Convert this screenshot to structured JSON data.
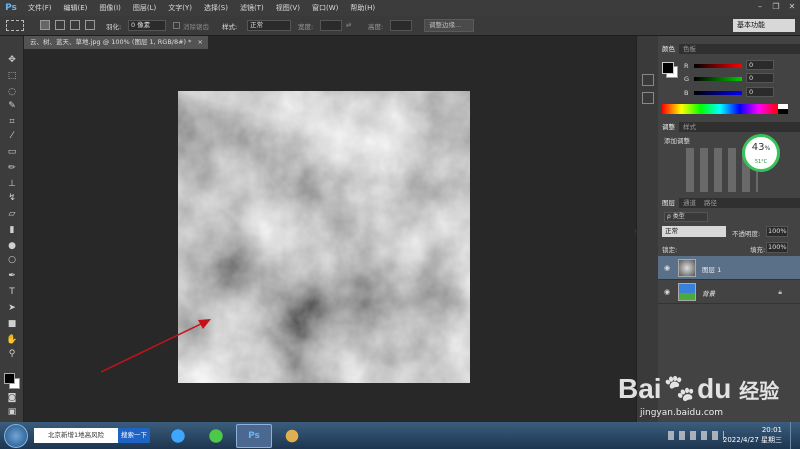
{
  "app": {
    "logo": "Ps",
    "menu": [
      "文件(F)",
      "编辑(E)",
      "图像(I)",
      "图层(L)",
      "文字(Y)",
      "选择(S)",
      "滤镜(T)",
      "视图(V)",
      "窗口(W)",
      "帮助(H)"
    ]
  },
  "options": {
    "feather_label": "羽化:",
    "feather_value": "0 像素",
    "antialias_label": "消除锯齿",
    "style_label": "样式:",
    "style_value": "正常",
    "width_label": "宽度:",
    "height_label": "高度:",
    "refine_edge": "调整边缘...",
    "workspace": "基本功能"
  },
  "document": {
    "tab_title": "云、树、蓝天、草地.jpg @ 100% (图层 1, RGB/8#) *",
    "close": "×"
  },
  "color_panel": {
    "tabs": [
      "颜色",
      "色板"
    ],
    "channels": [
      {
        "name": "R",
        "value": "0"
      },
      {
        "name": "G",
        "value": "0"
      },
      {
        "name": "B",
        "value": "0"
      }
    ]
  },
  "adjust_panel": {
    "tabs": [
      "调整",
      "样式"
    ],
    "title": "添加调整",
    "gauge_percent": "43",
    "gauge_unit": "%",
    "gauge_temp": "51°C"
  },
  "layers_panel": {
    "tabs": [
      "图层",
      "通道",
      "路径"
    ],
    "kind_label": "ρ 类型",
    "blend_mode": "正常",
    "opacity_label": "不透明度:",
    "opacity_value": "100%",
    "lock_label": "锁定:",
    "fill_label": "填充:",
    "fill_value": "100%",
    "layers": [
      {
        "name": "图层 1",
        "selected": true
      },
      {
        "name": "背景",
        "selected": false
      }
    ]
  },
  "taskbar": {
    "search_text": "北京新增1地高风险",
    "search_button": "搜索一下",
    "time": "20:01",
    "date": "2022/4/27 星期三"
  },
  "watermark": {
    "brand": "Bai",
    "brand_suffix": "du",
    "product": "经验",
    "url": "jingyan.baidu.com"
  }
}
